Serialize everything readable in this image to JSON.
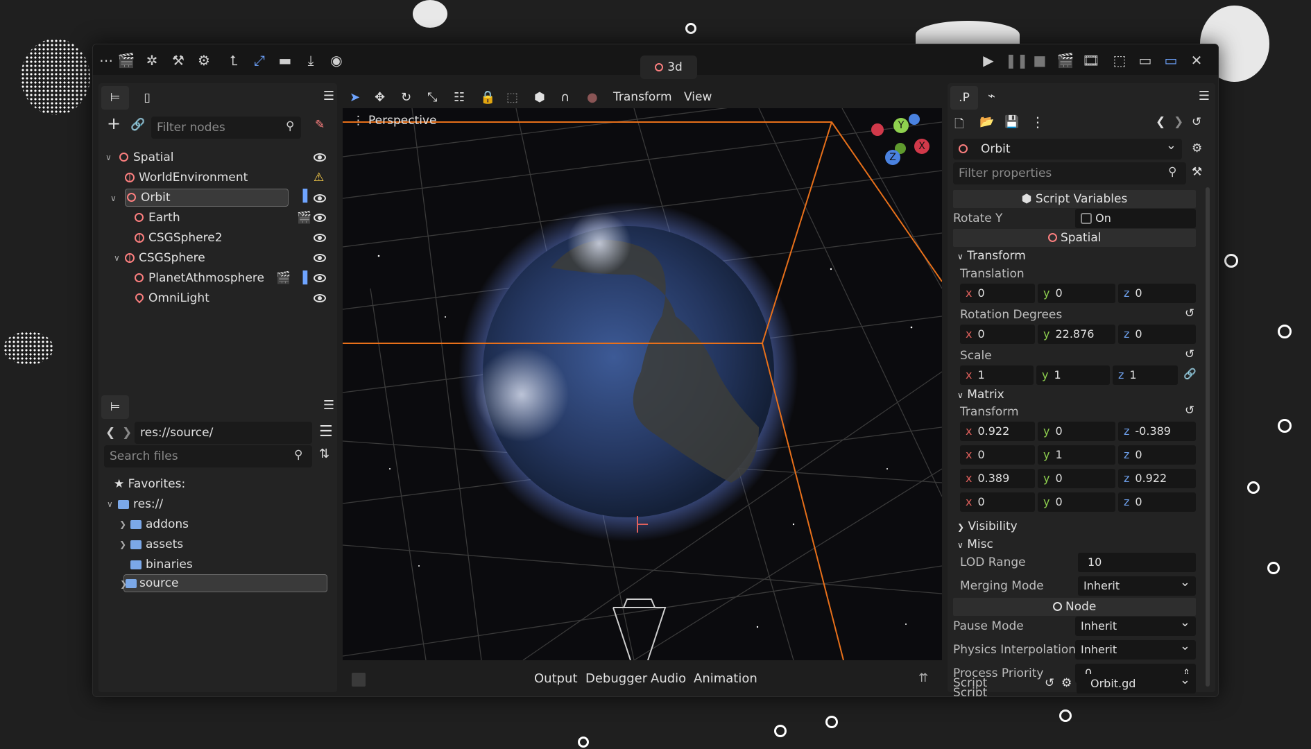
{
  "window": {
    "scene_tab": "3d"
  },
  "toolbar": {
    "transform_menu": "Transform",
    "view_menu": "View"
  },
  "scene_dock": {
    "filter_placeholder": "Filter nodes",
    "nodes": [
      {
        "name": "Spatial",
        "icon": "node-icon"
      },
      {
        "name": "WorldEnvironment",
        "icon": "globe-icon"
      },
      {
        "name": "Orbit",
        "icon": "node-icon"
      },
      {
        "name": "Earth",
        "icon": "node-icon"
      },
      {
        "name": "CSGSphere2",
        "icon": "csg-icon"
      },
      {
        "name": "CSGSphere",
        "icon": "csg-icon"
      },
      {
        "name": "PlanetAthmosphere",
        "icon": "node-icon"
      },
      {
        "name": "OmniLight",
        "icon": "light-icon"
      }
    ]
  },
  "filesystem": {
    "path": "res://source/",
    "search_placeholder": "Search files",
    "favorites": "Favorites:",
    "root": "res://",
    "folders": [
      "addons",
      "assets",
      "binaries",
      "source"
    ]
  },
  "viewport": {
    "label": "Perspective",
    "gizmo_axes": [
      "X",
      "Y",
      "Z"
    ]
  },
  "bottom_tabs": [
    "Output",
    "Debugger",
    "Audio",
    "Animation"
  ],
  "inspector": {
    "tab_label": ".P",
    "node_name": "Orbit",
    "filter_placeholder": "Filter properties",
    "script_variables": "Script Variables",
    "rotate_y_label": "Rotate Y",
    "rotate_y_value": "On",
    "spatial_section": "Spatial",
    "transform_group": "Transform",
    "translation_label": "Translation",
    "translation": {
      "x": "0",
      "y": "0",
      "z": "0"
    },
    "rotation_label": "Rotation Degrees",
    "rotation": {
      "x": "0",
      "y": "22.876",
      "z": "0"
    },
    "scale_label": "Scale",
    "scale": {
      "x": "1",
      "y": "1",
      "z": "1"
    },
    "matrix_group": "Matrix",
    "matrix_transform_label": "Transform",
    "matrix": [
      {
        "x": "0.922",
        "y": "0",
        "z": "-0.389"
      },
      {
        "x": "0",
        "y": "1",
        "z": "0"
      },
      {
        "x": "0.389",
        "y": "0",
        "z": "0.922"
      },
      {
        "x": "0",
        "y": "0",
        "z": "0"
      }
    ],
    "visibility_group": "Visibility",
    "misc_group": "Misc",
    "lod_range_label": "LOD Range",
    "lod_range_value": "10",
    "merging_mode_label": "Merging Mode",
    "merging_mode_value": "Inherit",
    "node_section": "Node",
    "pause_mode_label": "Pause Mode",
    "pause_mode_value": "Inherit",
    "physics_interp_label": "Physics Interpolation",
    "physics_interp_value": "Inherit",
    "process_priority_label": "Process Priority",
    "process_priority_value": "0",
    "script_label": "Script",
    "script_value": "Orbit.gd"
  },
  "colors": {
    "accent_blue": "#6ea4ff",
    "node_red": "#fc7f7f",
    "frustum_orange": "#e8701a"
  }
}
